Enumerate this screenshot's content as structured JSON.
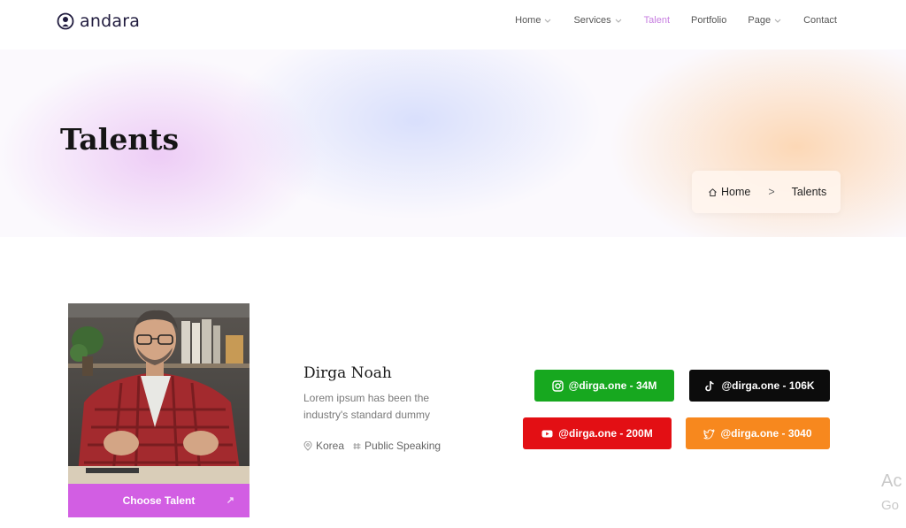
{
  "brand": {
    "name": "andara",
    "icon": "podcast-icon",
    "color": "#1f1a3d"
  },
  "nav": {
    "items": [
      {
        "label": "Home",
        "dropdown": true,
        "active": false
      },
      {
        "label": "Services",
        "dropdown": true,
        "active": false
      },
      {
        "label": "Talent",
        "dropdown": false,
        "active": true
      },
      {
        "label": "Portfolio",
        "dropdown": false,
        "active": false
      },
      {
        "label": "Page",
        "dropdown": true,
        "active": false
      },
      {
        "label": "Contact",
        "dropdown": false,
        "active": false
      }
    ],
    "active_color": "#c77ee0"
  },
  "hero": {
    "title": "Talents",
    "breadcrumb": {
      "home": "Home",
      "separator": ">",
      "current": "Talents"
    }
  },
  "talent": {
    "name": "Dirga Noah",
    "description": "Lorem ipsum has been the industry's standard dummy",
    "location": "Korea",
    "category": "Public Speaking",
    "cta": "Choose Talent",
    "cta_color": "#d25ee3",
    "socials": [
      {
        "platform": "instagram-icon",
        "label": "@dirga.one - 34M",
        "color": "#17a81f"
      },
      {
        "platform": "tiktok-icon",
        "label": "@dirga.one - 106K",
        "color": "#0c0c0c"
      },
      {
        "platform": "youtube-icon",
        "label": "@dirga.one - 200M",
        "color": "#e30f14"
      },
      {
        "platform": "twitter-icon",
        "label": "@dirga.one - 3040",
        "color": "#f7881e"
      }
    ]
  },
  "watermark": {
    "line1": "Ac",
    "line2": "Go"
  }
}
